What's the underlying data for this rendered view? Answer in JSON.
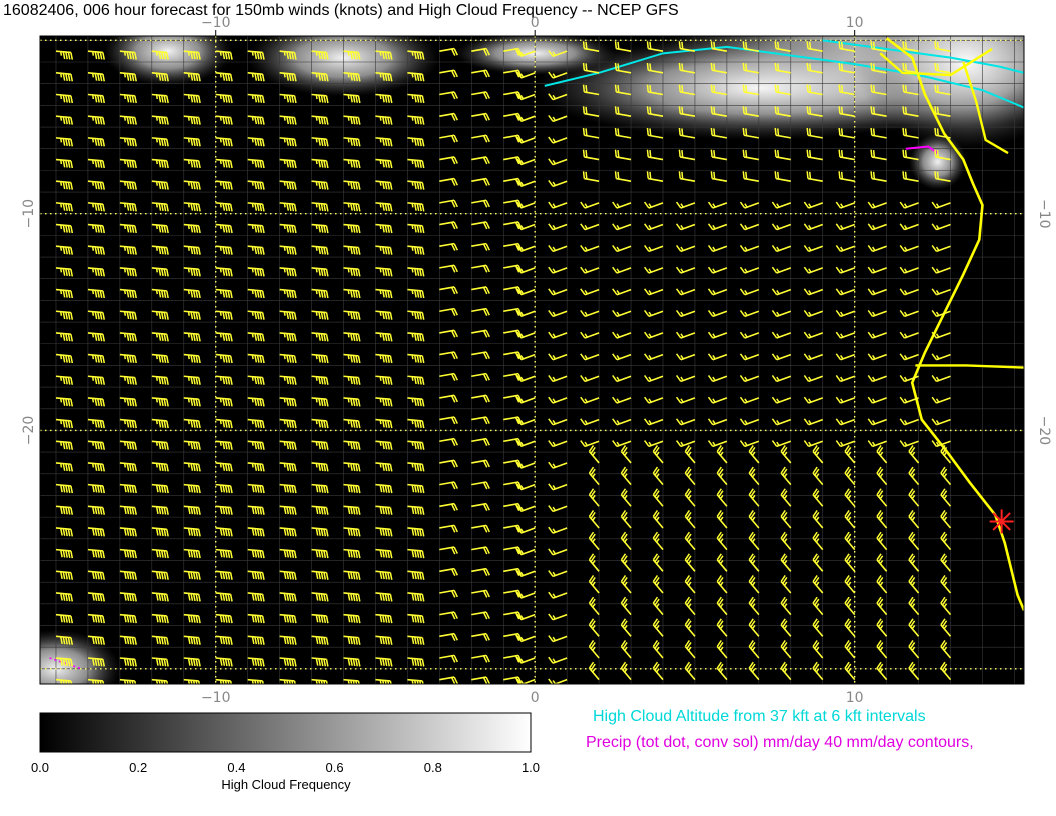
{
  "title": "16082406, 006 hour forecast for 150mb winds (knots) and High Cloud Frequency -- NCEP GFS",
  "axes": {
    "x_ticks": [
      {
        "value": -10,
        "label": "−10"
      },
      {
        "value": 0,
        "label": "0"
      },
      {
        "value": 10,
        "label": "10"
      }
    ],
    "y_ticks": [
      {
        "value": -10,
        "label": "−10"
      },
      {
        "value": -20,
        "label": "−20"
      }
    ],
    "xlim": [
      -15.5,
      15.3
    ],
    "ylim": [
      -31.7,
      -1.8
    ]
  },
  "colorbar": {
    "label": "High Cloud Frequency",
    "ticks": [
      "0.0",
      "0.2",
      "0.4",
      "0.6",
      "0.8",
      "1.0"
    ],
    "range": [
      0,
      1
    ]
  },
  "legend_notes": {
    "cloud_altitude": "High Cloud Altitude from 37 kft at 6 kft intervals",
    "precip": "Precip (tot dot, conv sol) mm/day 40 mm/day contours,"
  },
  "colors": {
    "background_map": "#000000",
    "wind_barbs": "#ffff33",
    "coastline": "#ffff00",
    "cloud_altitude_contours": "#00e5e5",
    "precip_contours": "#ff00ff",
    "grid_dots": "#ffff66",
    "marker_star": "#ff2020",
    "cloud_frequency_high": "#ffffff"
  },
  "marker": {
    "name": "red-star-marker",
    "lon": 14.6,
    "lat": -24.2
  },
  "wind_regions": [
    {
      "name": "west-strong-easterly",
      "lon_max": -3,
      "dir_from": 95,
      "speed": 45
    },
    {
      "name": "northeast-westerly",
      "lon_min": 1,
      "lat_max": -2,
      "lat_min": -9,
      "dir_from": 280,
      "speed": 20
    },
    {
      "name": "south-northwesterly",
      "lon_min": 1,
      "lat_max": -21,
      "dir_from": 320,
      "speed": 25
    }
  ]
}
